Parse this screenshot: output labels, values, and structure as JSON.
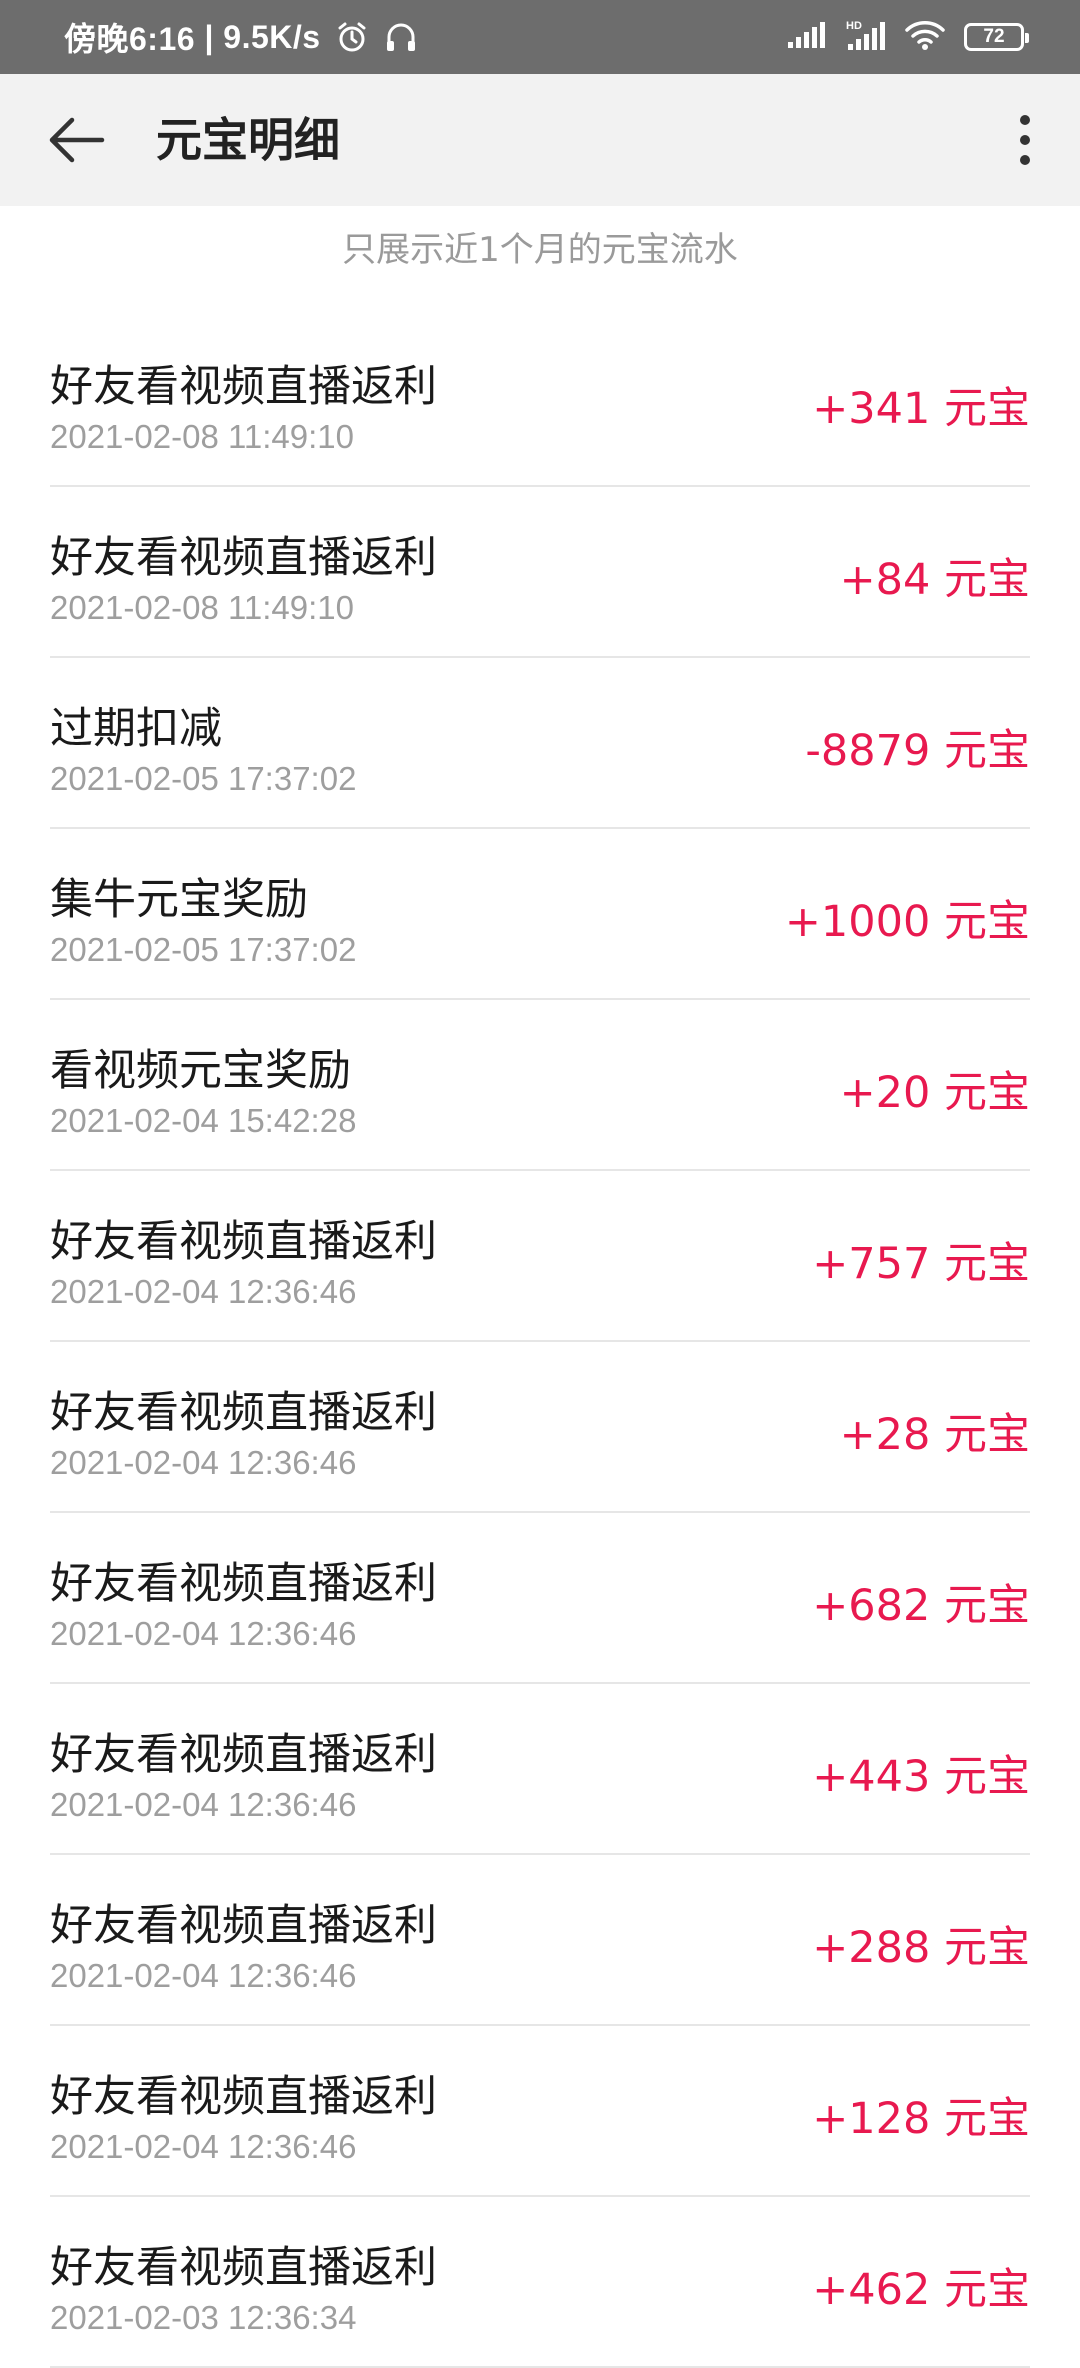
{
  "status_bar": {
    "time": "傍晚6:16",
    "speed": "9.5K/s",
    "battery": "72"
  },
  "header": {
    "title": "元宝明细"
  },
  "notice": "只展示近1个月的元宝流水",
  "records": [
    {
      "title": "好友看视频直播返利",
      "time": "2021-02-08 11:49:10",
      "amount": "+341 元宝"
    },
    {
      "title": "好友看视频直播返利",
      "time": "2021-02-08 11:49:10",
      "amount": "+84 元宝"
    },
    {
      "title": "过期扣减",
      "time": "2021-02-05 17:37:02",
      "amount": "-8879 元宝"
    },
    {
      "title": "集牛元宝奖励",
      "time": "2021-02-05 17:37:02",
      "amount": "+1000 元宝"
    },
    {
      "title": "看视频元宝奖励",
      "time": "2021-02-04 15:42:28",
      "amount": "+20 元宝"
    },
    {
      "title": "好友看视频直播返利",
      "time": "2021-02-04 12:36:46",
      "amount": "+757 元宝"
    },
    {
      "title": "好友看视频直播返利",
      "time": "2021-02-04 12:36:46",
      "amount": "+28 元宝"
    },
    {
      "title": "好友看视频直播返利",
      "time": "2021-02-04 12:36:46",
      "amount": "+682 元宝"
    },
    {
      "title": "好友看视频直播返利",
      "time": "2021-02-04 12:36:46",
      "amount": "+443 元宝"
    },
    {
      "title": "好友看视频直播返利",
      "time": "2021-02-04 12:36:46",
      "amount": "+288 元宝"
    },
    {
      "title": "好友看视频直播返利",
      "time": "2021-02-04 12:36:46",
      "amount": "+128 元宝"
    },
    {
      "title": "好友看视频直播返利",
      "time": "2021-02-03 12:36:34",
      "amount": "+462 元宝"
    }
  ],
  "colors": {
    "amount": "#e8194f",
    "status_bar": "#6d6d6d",
    "app_bar": "#f2f2f2"
  }
}
